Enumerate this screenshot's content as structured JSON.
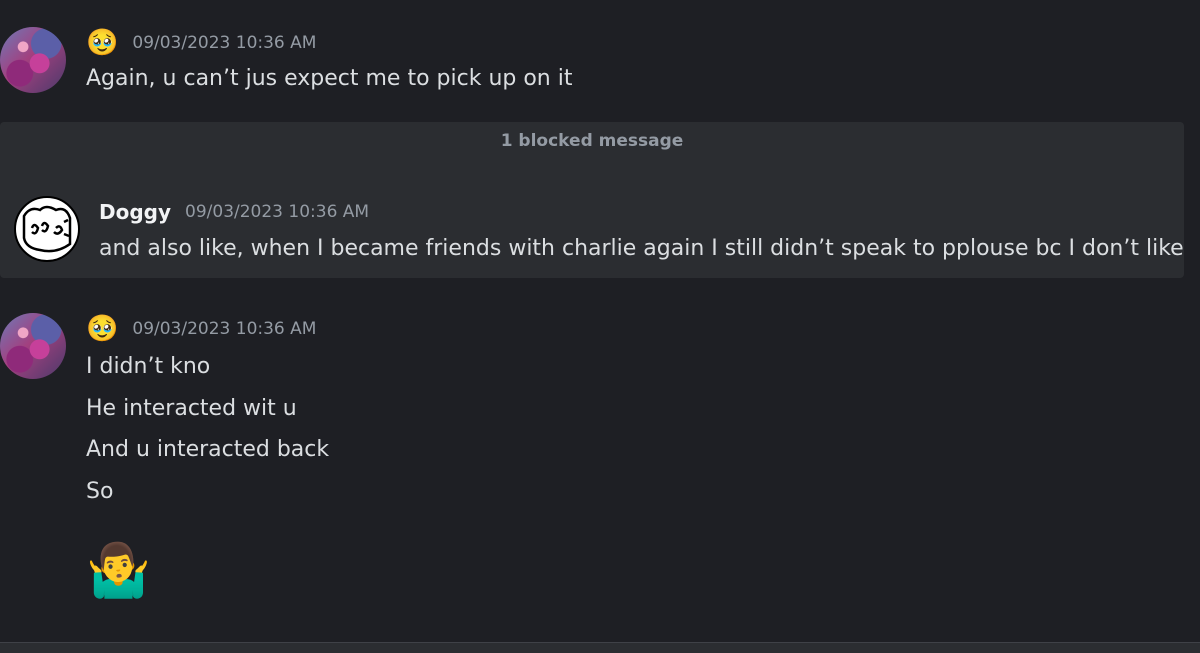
{
  "messages": [
    {
      "emoji_name": "🥹",
      "timestamp": "09/03/2023 10:36 AM",
      "lines": [
        "Again, u can’t jus expect me to pick up on it"
      ]
    }
  ],
  "blocked": {
    "label": "1 blocked message"
  },
  "doggy_message": {
    "username": "Doggy",
    "timestamp": "09/03/2023 10:36 AM",
    "text": "and also like, when I became friends with charlie again I still didn’t speak to pplouse bc I don’t like him"
  },
  "second_message": {
    "emoji_name": "🥹",
    "timestamp": "09/03/2023 10:36 AM",
    "lines": [
      "I didn’t kno",
      "He interacted wit u",
      "And u interacted back",
      "So"
    ],
    "emoji": "🤷‍♂️"
  }
}
